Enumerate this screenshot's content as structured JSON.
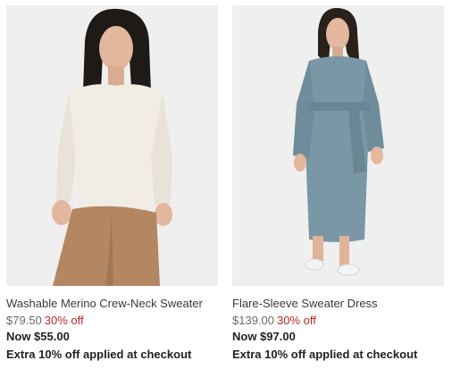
{
  "products": [
    {
      "name": "Washable Merino Crew-Neck Sweater",
      "original_price": "$79.50",
      "discount": "30% off",
      "now_price": "Now $55.00",
      "promo": "Extra 10% off applied at checkout",
      "colors": {
        "sweater": "#f1ece4",
        "pants": "#b48662",
        "background": "#efefef"
      }
    },
    {
      "name": "Flare-Sleeve Sweater Dress",
      "original_price": "$139.00",
      "discount": "30% off",
      "now_price": "Now $97.00",
      "promo": "Extra 10% off applied at checkout",
      "colors": {
        "dress": "#7a97a6",
        "background": "#efefef"
      }
    }
  ],
  "accent_colors": {
    "discount": "#c0262d",
    "text": "#333333"
  }
}
